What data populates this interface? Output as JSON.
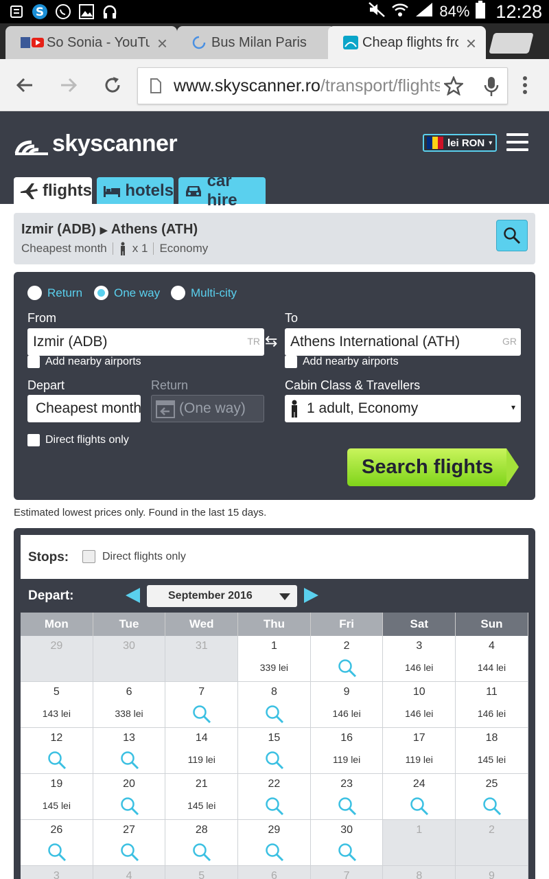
{
  "status_bar": {
    "battery": "84%",
    "time": "12:28",
    "icons": [
      "notes-icon",
      "skype-icon",
      "whatsapp-icon",
      "image-icon",
      "headset-icon",
      "mute-icon",
      "wifi-icon",
      "signal-icon",
      "battery-icon"
    ]
  },
  "browser": {
    "tabs": [
      {
        "title": "So Sonia - YouTube",
        "icon": "facebook-youtube-icon"
      },
      {
        "title": "Bus Milan Paris",
        "icon": "loading-icon"
      },
      {
        "title": "Cheap flights from",
        "icon": "skyscanner-icon",
        "active": true
      }
    ],
    "url_host": "www.skyscanner.ro",
    "url_path": "/transport/flights"
  },
  "site": {
    "brand": "skyscanner",
    "currency": "lei RON",
    "nav_tabs": [
      {
        "label": "flights",
        "icon": "plane-icon"
      },
      {
        "label": "hotels",
        "icon": "bed-icon"
      },
      {
        "label": "car hire",
        "icon": "car-icon"
      }
    ]
  },
  "summary": {
    "route_from": "Izmir (ADB)",
    "route_to": "Athens (ATH)",
    "when": "Cheapest month",
    "travellers": "x 1",
    "cabin": "Economy"
  },
  "form": {
    "trip_types": [
      "Return",
      "One way",
      "Multi-city"
    ],
    "selected_trip": "One way",
    "from_label": "From",
    "from_value": "Izmir (ADB)",
    "from_country": "TR",
    "to_label": "To",
    "to_value": "Athens International (ATH)",
    "to_country": "GR",
    "nearby_label": "Add nearby airports",
    "depart_label": "Depart",
    "depart_value": "Cheapest month",
    "return_label": "Return",
    "return_value": "(One way)",
    "cabin_label": "Cabin Class & Travellers",
    "cabin_value": "1 adult, Economy",
    "direct_label": "Direct flights only",
    "search_button": "Search flights"
  },
  "note": "Estimated lowest prices only. Found in the last 15 days.",
  "calendar": {
    "stops_label": "Stops:",
    "direct_label": "Direct flights only",
    "depart_label": "Depart:",
    "month": "September 2016",
    "weekdays": [
      "Mon",
      "Tue",
      "Wed",
      "Thu",
      "Fri",
      "Sat",
      "Sun"
    ],
    "weeks": [
      [
        {
          "d": "29",
          "o": true
        },
        {
          "d": "30",
          "o": true
        },
        {
          "d": "31",
          "o": true
        },
        {
          "d": "1",
          "p": "339 lei"
        },
        {
          "d": "2",
          "s": true
        },
        {
          "d": "3",
          "p": "146 lei"
        },
        {
          "d": "4",
          "p": "144 lei"
        }
      ],
      [
        {
          "d": "5",
          "p": "143 lei"
        },
        {
          "d": "6",
          "p": "338 lei"
        },
        {
          "d": "7",
          "s": true
        },
        {
          "d": "8",
          "s": true
        },
        {
          "d": "9",
          "p": "146 lei"
        },
        {
          "d": "10",
          "p": "146 lei"
        },
        {
          "d": "11",
          "p": "146 lei"
        }
      ],
      [
        {
          "d": "12",
          "s": true
        },
        {
          "d": "13",
          "s": true
        },
        {
          "d": "14",
          "p": "119 lei"
        },
        {
          "d": "15",
          "s": true
        },
        {
          "d": "16",
          "p": "119 lei"
        },
        {
          "d": "17",
          "p": "119 lei"
        },
        {
          "d": "18",
          "p": "145 lei"
        }
      ],
      [
        {
          "d": "19",
          "p": "145 lei"
        },
        {
          "d": "20",
          "s": true
        },
        {
          "d": "21",
          "p": "145 lei"
        },
        {
          "d": "22",
          "s": true
        },
        {
          "d": "23",
          "s": true
        },
        {
          "d": "24",
          "s": true
        },
        {
          "d": "25",
          "s": true
        }
      ],
      [
        {
          "d": "26",
          "s": true
        },
        {
          "d": "27",
          "s": true
        },
        {
          "d": "28",
          "s": true
        },
        {
          "d": "29",
          "s": true
        },
        {
          "d": "30",
          "s": true
        },
        {
          "d": "1",
          "o": true
        },
        {
          "d": "2",
          "o": true
        }
      ],
      [
        {
          "d": "3",
          "o": true
        },
        {
          "d": "4",
          "o": true
        },
        {
          "d": "5",
          "o": true
        },
        {
          "d": "6",
          "o": true
        },
        {
          "d": "7",
          "o": true
        },
        {
          "d": "8",
          "o": true
        },
        {
          "d": "9",
          "o": true
        }
      ]
    ]
  },
  "colors": {
    "accent": "#5ad0ee",
    "header_bg": "#3a3e48",
    "search_green": "#7fd41a"
  }
}
